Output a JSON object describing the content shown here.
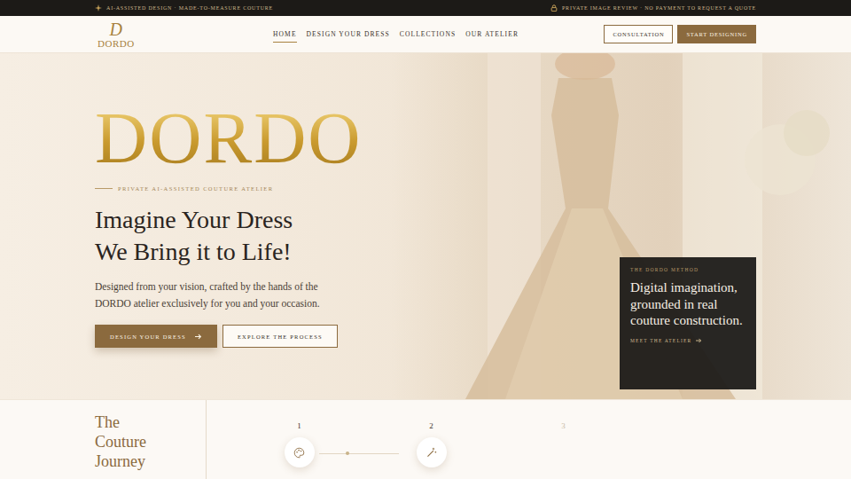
{
  "announcement": {
    "left": "AI-ASSISTED DESIGN · MADE-TO-MEASURE COUTURE",
    "right": "PRIVATE IMAGE REVIEW · NO PAYMENT TO REQUEST A QUOTE"
  },
  "logo": {
    "monogram": "D",
    "name": "DORDO"
  },
  "nav": [
    {
      "label": "HOME",
      "selected": true
    },
    {
      "label": "DESIGN YOUR DRESS",
      "selected": false
    },
    {
      "label": "COLLECTIONS",
      "selected": false
    },
    {
      "label": "OUR ATELIER",
      "selected": false
    }
  ],
  "header_buttons": {
    "secondary": "CONSULTATION",
    "primary": "START DESIGNING"
  },
  "hero": {
    "wordmark": "DORDO",
    "eyebrow": "PRIVATE AI-ASSISTED COUTURE ATELIER",
    "title_lines": [
      "Imagine Your Dress",
      "We Bring it to Life!"
    ],
    "text": "Designed from your vision, crafted by the hands of the DORDO atelier exclusively for you and your occasion.",
    "primary": "DESIGN YOUR DRESS",
    "secondary": "EXPLORE THE PROCESS"
  },
  "method_card": {
    "eyebrow": "THE DORDO METHOD",
    "title": "Digital imagination, grounded in real couture construction.",
    "link": "MEET THE ATELIER"
  },
  "journey": {
    "title": "The Couture Journey",
    "steps": [
      {
        "number": "1",
        "active": true
      },
      {
        "number": "2",
        "active": true
      },
      {
        "number": "3",
        "active": false
      }
    ]
  }
}
